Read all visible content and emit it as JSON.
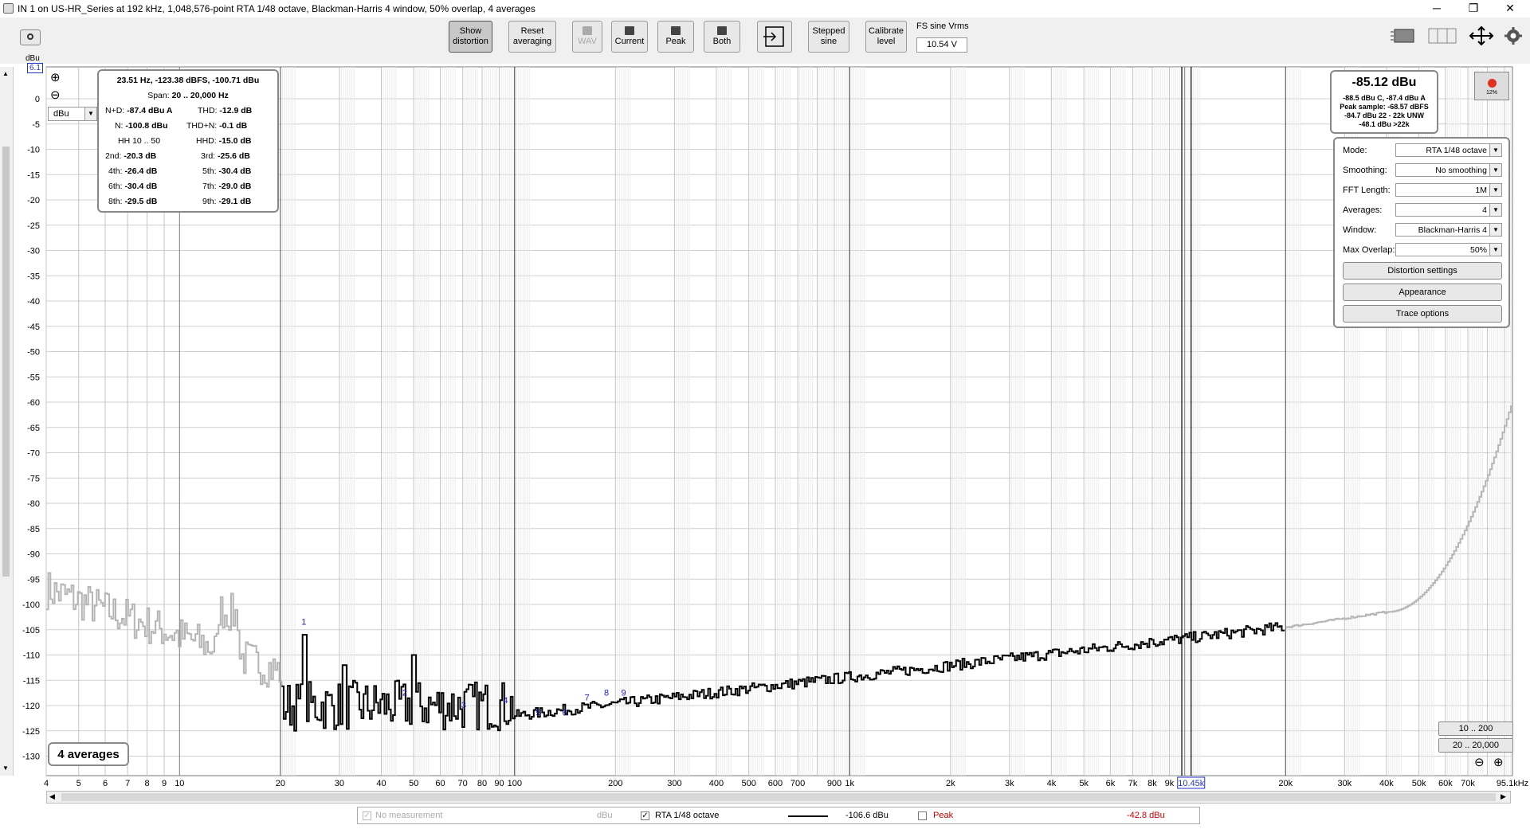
{
  "window": {
    "title": "IN 1 on US-HR_Series at 192 kHz, 1,048,576-point RTA 1/48 octave, Blackman-Harris 4 window, 50% overlap, 4 averages",
    "controls": {
      "minimize": "─",
      "restore": "❐",
      "close": "✕"
    }
  },
  "toolbar": {
    "show_distortion": [
      "Show",
      "distortion"
    ],
    "reset_averaging": [
      "Reset",
      "averaging"
    ],
    "wav": "WAV",
    "current": "Current",
    "peak": "Peak",
    "both": "Both",
    "stepped_sine": [
      "Stepped",
      "sine"
    ],
    "calibrate_level": [
      "Calibrate",
      "level"
    ],
    "fs_label": "FS sine Vrms",
    "fs_value": "10.54 V"
  },
  "stats": {
    "header": "23.51 Hz, -123.38 dBFS, -100.71 dBu",
    "span_label": "Span:",
    "span_value": "20 .. 20,000 Hz",
    "nd_label": "N+D:",
    "nd_value": "-87.4 dBu A",
    "thd_label": "THD:",
    "thd_value": "-12.9 dB",
    "n_label": "N:",
    "n_value": "-100.8 dBu",
    "thdn_label": "THD+N:",
    "thdn_value": "-0.1 dB",
    "hh_label": "HH 10 .. 50",
    "hhd_label": "HHD:",
    "hhd_value": "-15.0 dB",
    "harmonics": [
      {
        "l1": "2nd:",
        "v1": "-20.3 dB",
        "l2": "3rd:",
        "v2": "-25.6 dB"
      },
      {
        "l1": "4th:",
        "v1": "-26.4 dB",
        "l2": "5th:",
        "v2": "-30.4 dB"
      },
      {
        "l1": "6th:",
        "v1": "-30.4 dB",
        "l2": "7th:",
        "v2": "-29.0 dB"
      },
      {
        "l1": "8th:",
        "v1": "-29.5 dB",
        "l2": "9th:",
        "v2": "-29.1 dB"
      }
    ]
  },
  "level": {
    "main": "-85.12 dBu",
    "lines": [
      "-88.5 dBu C, -87.4 dBu A",
      "Peak sample: -68.57 dBFS",
      "-84.7 dBu 22 - 22k UNW",
      "-48.1 dBu >22k"
    ],
    "record_pct": "12%"
  },
  "settings": {
    "mode_label": "Mode:",
    "mode_value": "RTA 1/48 octave",
    "smoothing_label": "Smoothing:",
    "smoothing_value": "No  smoothing",
    "fft_label": "FFT Length:",
    "fft_value": "1M",
    "averages_label": "Averages:",
    "averages_value": "4",
    "window_label": "Window:",
    "window_value": "Blackman-Harris 4",
    "overlap_label": "Max Overlap:",
    "overlap_value": "50%",
    "distortion_btn": "Distortion settings",
    "appearance_btn": "Appearance",
    "trace_btn": "Trace options"
  },
  "plot": {
    "unit": "dBu",
    "top_marker": "6.1",
    "y_ticks": [
      "0",
      "-5",
      "-10",
      "-15",
      "-20",
      "-25",
      "-30",
      "-35",
      "-40",
      "-45",
      "-50",
      "-55",
      "-60",
      "-65",
      "-70",
      "-75",
      "-80",
      "-85",
      "-90",
      "-95",
      "-100",
      "-105",
      "-110",
      "-115",
      "-120",
      "-125",
      "-130"
    ],
    "x_ticks": [
      "4",
      "5",
      "6",
      "7",
      "8",
      "9",
      "10",
      "20",
      "30",
      "40",
      "50",
      "60",
      "70",
      "80",
      "90",
      "100",
      "200",
      "300",
      "400",
      "500",
      "600",
      "700",
      "900",
      "1k",
      "2k",
      "3k",
      "4k",
      "5k",
      "6k",
      "7k",
      "8k",
      "9k",
      "10.45k",
      "20k",
      "30k",
      "40k",
      "50k",
      "60k",
      "70k",
      "95.1kHz"
    ],
    "cursor_label": "10.45k",
    "harmonic_labels": [
      "1",
      "2",
      "3",
      "4",
      "5",
      "6",
      "7",
      "8",
      "9"
    ],
    "averages_label": "4 averages",
    "range_btn_1": "10 .. 200",
    "range_btn_2": "20 .. 20,000",
    "zoom_in": "⊕",
    "zoom_out": "⊖"
  },
  "legend": {
    "no_measurement": "No measurement",
    "no_measurement_unit": "dBu",
    "rta": "RTA 1/48 octave",
    "rta_value": "-106.6 dBu",
    "peak": "Peak",
    "peak_value": "-42.8 dBu",
    "peak_color": "#cc0000"
  },
  "colors": {
    "trace": "#000000",
    "trace_out_of_span": "#b5b5b5",
    "harmonic_labels": "#2020c0",
    "record": "#e03020"
  }
}
